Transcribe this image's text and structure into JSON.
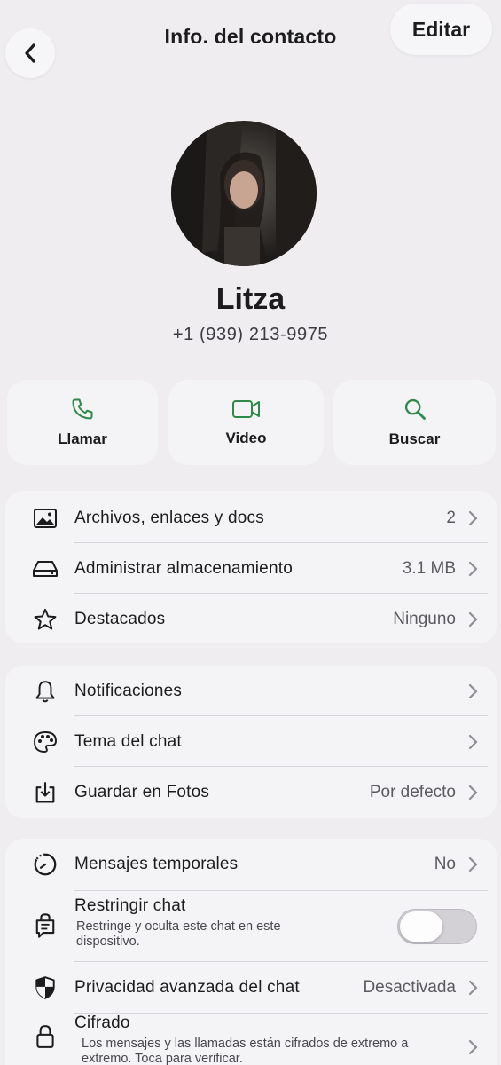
{
  "header": {
    "title": "Info. del contacto",
    "edit_label": "Editar"
  },
  "contact": {
    "name": "Litza",
    "phone": "+1 (939) 213-9975"
  },
  "actions": [
    {
      "label": "Llamar",
      "icon": "phone-icon"
    },
    {
      "label": "Video",
      "icon": "video-camera-icon"
    },
    {
      "label": "Buscar",
      "icon": "search-icon"
    }
  ],
  "media_section": {
    "items": [
      {
        "label": "Archivos, enlaces y docs",
        "value": "2",
        "icon": "image-icon"
      },
      {
        "label": "Administrar almacenamiento",
        "value": "3.1 MB",
        "icon": "storage-drive-icon"
      },
      {
        "label": "Destacados",
        "value": "Ninguno",
        "icon": "star-icon"
      }
    ]
  },
  "chat_section": {
    "items": [
      {
        "label": "Notificaciones",
        "value": "",
        "icon": "bell-icon"
      },
      {
        "label": "Tema del chat",
        "value": "",
        "icon": "palette-icon"
      },
      {
        "label": "Guardar en Fotos",
        "value": "Por defecto",
        "icon": "save-download-icon"
      }
    ]
  },
  "privacy_section": {
    "temporary": {
      "label": "Mensajes temporales",
      "value": "No",
      "icon": "timer-icon"
    },
    "restrict": {
      "label": "Restringir chat",
      "subtitle_line1": "Restringe y oculta este chat en este",
      "subtitle_line2": "dispositivo.",
      "toggle_on": false,
      "icon": "restrict-chat-icon"
    },
    "advanced": {
      "label": "Privacidad avanzada del chat",
      "value": "Desactivada",
      "icon": "shield-icon"
    },
    "encryption": {
      "label": "Cifrado",
      "subtitle_line1": "Los mensajes y las llamadas están cifrados de extremo a",
      "subtitle_line2": "extremo. Toca para verificar.",
      "icon": "lock-icon"
    }
  },
  "colors": {
    "accent_green": "#2d8a48",
    "background": "#efedf0",
    "card": "#f4f3f5"
  }
}
